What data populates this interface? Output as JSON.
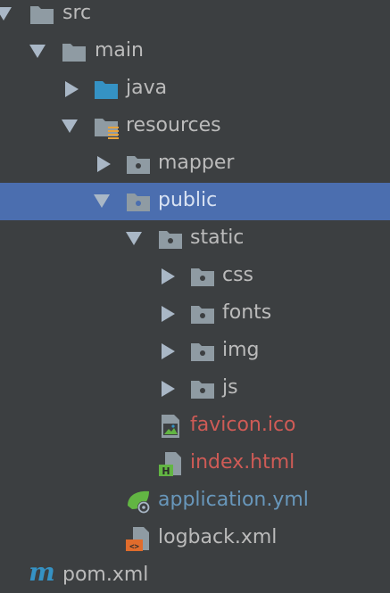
{
  "colors": {
    "background": "#3c3f41",
    "selection": "#4b6eaf",
    "text_default": "#bbbbbb",
    "text_modified": "#cf5b56",
    "text_blue": "#6897bb",
    "folder_grey": "#8f9ba3",
    "folder_source": "#3592c4"
  },
  "tree": {
    "src": {
      "label": "src",
      "icon": "folder-icon",
      "expanded": true
    },
    "main": {
      "label": "main",
      "icon": "folder-icon",
      "expanded": true
    },
    "java": {
      "label": "java",
      "icon": "source-folder-icon",
      "expanded": false
    },
    "resources": {
      "label": "resources",
      "icon": "resources-folder-icon",
      "expanded": true
    },
    "mapper": {
      "label": "mapper",
      "icon": "package-folder-icon",
      "expanded": false
    },
    "public": {
      "label": "public",
      "icon": "package-folder-icon",
      "expanded": true,
      "selected": true
    },
    "static": {
      "label": "static",
      "icon": "package-folder-icon",
      "expanded": true
    },
    "css": {
      "label": "css",
      "icon": "package-folder-icon",
      "expanded": false
    },
    "fonts": {
      "label": "fonts",
      "icon": "package-folder-icon",
      "expanded": false
    },
    "img": {
      "label": "img",
      "icon": "package-folder-icon",
      "expanded": false
    },
    "js": {
      "label": "js",
      "icon": "package-folder-icon",
      "expanded": false
    },
    "favicon": {
      "label": "favicon.ico",
      "icon": "image-file-icon"
    },
    "index": {
      "label": "index.html",
      "icon": "html-file-icon"
    },
    "application": {
      "label": "application.yml",
      "icon": "spring-config-icon"
    },
    "logback": {
      "label": "logback.xml",
      "icon": "xml-file-icon"
    },
    "pom": {
      "label": "pom.xml",
      "icon": "maven-icon"
    }
  }
}
